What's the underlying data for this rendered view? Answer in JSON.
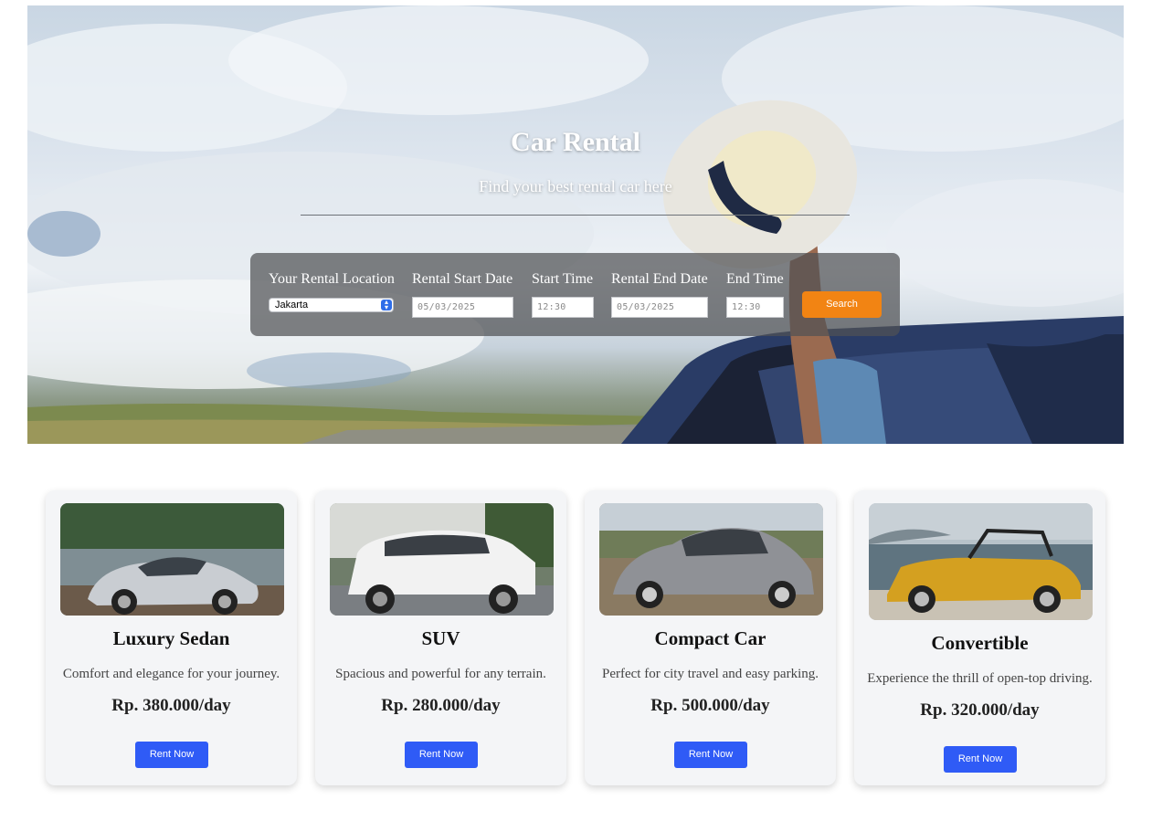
{
  "hero": {
    "title": "Car Rental",
    "subtitle": "Find your best rental car here"
  },
  "search": {
    "location_label": "Your Rental Location",
    "location_value": "Jakarta",
    "start_date_label": "Rental Start Date",
    "start_date_value": "05/03/2025",
    "start_time_label": "Start Time",
    "start_time_value": "12:30",
    "end_date_label": "Rental End Date",
    "end_date_value": "05/03/2025",
    "end_time_label": "End Time",
    "end_time_value": "12:30",
    "button_label": "Search"
  },
  "cars": [
    {
      "title": "Luxury Sedan",
      "description": "Comfort and elegance for your journey.",
      "price": "Rp. 380.000/day",
      "button": "Rent Now",
      "color": "#c9cdd2"
    },
    {
      "title": "SUV",
      "description": "Spacious and powerful for any terrain.",
      "price": "Rp. 280.000/day",
      "button": "Rent Now",
      "color": "#f2f2f2"
    },
    {
      "title": "Compact Car",
      "description": "Perfect for city travel and easy parking.",
      "price": "Rp. 500.000/day",
      "button": "Rent Now",
      "color": "#8f9196"
    },
    {
      "title": "Convertible",
      "description": "Experience the thrill of open-top driving.",
      "price": "Rp. 320.000/day",
      "button": "Rent Now",
      "color": "#d4a020"
    }
  ],
  "colors": {
    "search_button": "#f28413",
    "rent_button": "#2f5bf6",
    "card_background": "#f4f5f7"
  }
}
